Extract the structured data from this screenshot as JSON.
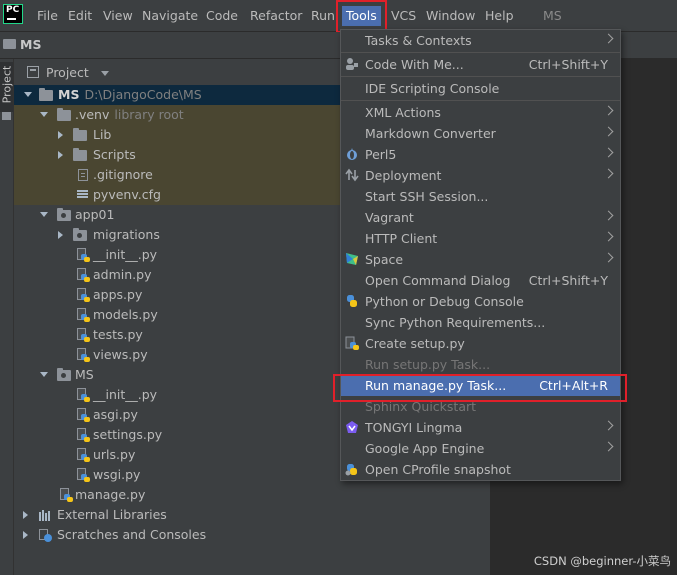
{
  "menubar": {
    "app_logo": "PC",
    "items": [
      "File",
      "Edit",
      "View",
      "Navigate",
      "Code",
      "Refactor",
      "Run",
      "Tools",
      "VCS",
      "Window",
      "Help"
    ],
    "project_name": "MS"
  },
  "navbar": {
    "title": "MS"
  },
  "toolstrip": {
    "tab_label": "Project"
  },
  "project_panel": {
    "title": "Project",
    "tree": [
      {
        "label": "MS",
        "sub": "D:\\DjangoCode\\MS"
      },
      {
        "label": ".venv",
        "sub": "library root"
      },
      {
        "label": "Lib"
      },
      {
        "label": "Scripts"
      },
      {
        "label": ".gitignore"
      },
      {
        "label": "pyvenv.cfg"
      },
      {
        "label": "app01"
      },
      {
        "label": "migrations"
      },
      {
        "label": "__init__.py"
      },
      {
        "label": "admin.py"
      },
      {
        "label": "apps.py"
      },
      {
        "label": "models.py"
      },
      {
        "label": "tests.py"
      },
      {
        "label": "views.py"
      },
      {
        "label": "MS"
      },
      {
        "label": "__init__.py"
      },
      {
        "label": "asgi.py"
      },
      {
        "label": "settings.py"
      },
      {
        "label": "urls.py"
      },
      {
        "label": "wsgi.py"
      },
      {
        "label": "manage.py"
      },
      {
        "label": "External Libraries"
      },
      {
        "label": "Scratches and Consoles"
      }
    ]
  },
  "tools_menu": {
    "items": [
      {
        "label": "Tasks & Contexts",
        "shortcut": ""
      },
      {
        "label": "Code With Me...",
        "shortcut": "Ctrl+Shift+Y"
      },
      {
        "label": "IDE Scripting Console",
        "shortcut": ""
      },
      {
        "label": "XML Actions",
        "shortcut": ""
      },
      {
        "label": "Markdown Converter",
        "shortcut": ""
      },
      {
        "label": "Perl5",
        "shortcut": ""
      },
      {
        "label": "Deployment",
        "shortcut": ""
      },
      {
        "label": "Start SSH Session...",
        "shortcut": ""
      },
      {
        "label": "Vagrant",
        "shortcut": ""
      },
      {
        "label": "HTTP Client",
        "shortcut": ""
      },
      {
        "label": "Space",
        "shortcut": ""
      },
      {
        "label": "Open Command Dialog",
        "shortcut": "Ctrl+Shift+Y"
      },
      {
        "label": "Python or Debug Console",
        "shortcut": ""
      },
      {
        "label": "Sync Python Requirements...",
        "shortcut": ""
      },
      {
        "label": "Create setup.py",
        "shortcut": ""
      },
      {
        "label": "Run setup.py Task...",
        "shortcut": ""
      },
      {
        "label": "Run manage.py Task...",
        "shortcut": "Ctrl+Alt+R"
      },
      {
        "label": "Sphinx Quickstart",
        "shortcut": ""
      },
      {
        "label": "TONGYI Lingma",
        "shortcut": ""
      },
      {
        "label": "Google App Engine",
        "shortcut": ""
      },
      {
        "label": "Open CProfile snapshot",
        "shortcut": ""
      }
    ]
  },
  "watermark": "CSDN @beginner-小菜鸟",
  "colors": {
    "highlight": "#4b6eaf",
    "annotation_box": "#e0202a",
    "selected_row": "#0d293e",
    "excluded_row": "#4a4631"
  }
}
